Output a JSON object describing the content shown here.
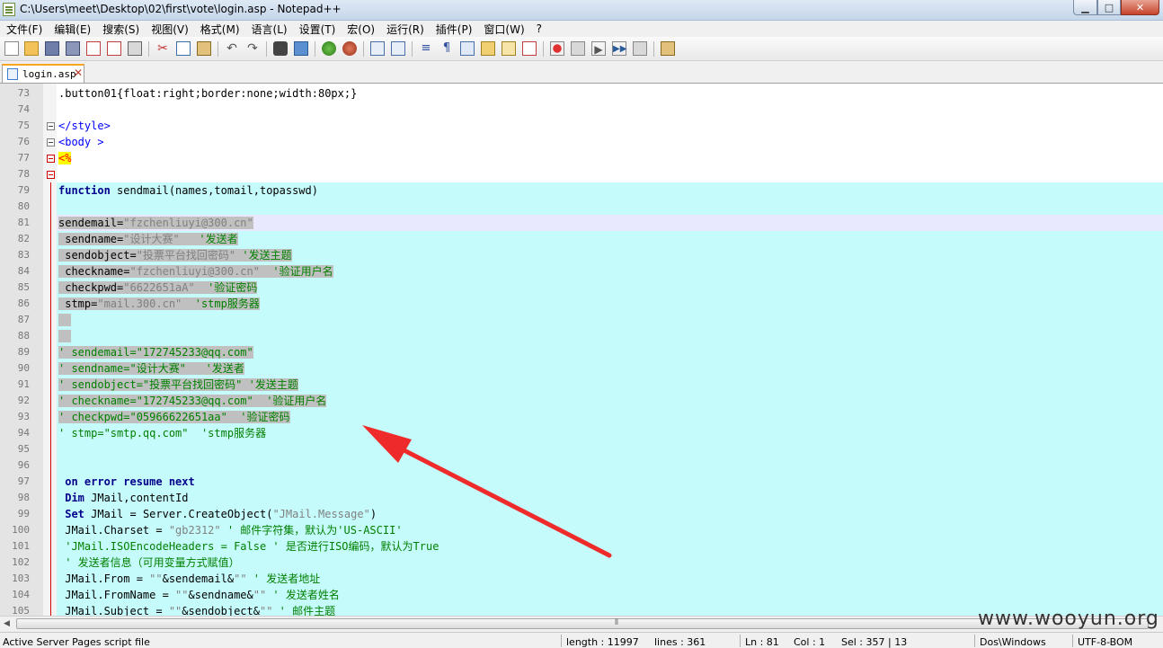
{
  "window": {
    "title": "C:\\Users\\meet\\Desktop\\02\\first\\vote\\login.asp - Notepad++",
    "min_glyph": "▁",
    "max_glyph": "□",
    "close_glyph": "✕"
  },
  "menu": [
    "文件(F)",
    "编辑(E)",
    "搜索(S)",
    "视图(V)",
    "格式(M)",
    "语言(L)",
    "设置(T)",
    "宏(O)",
    "运行(R)",
    "插件(P)",
    "窗口(W)",
    "?"
  ],
  "tab": {
    "label": "login.asp",
    "close": "✕"
  },
  "lines": [
    {
      "n": "73",
      "segs": [
        {
          "t": ".button01{float:right;border:none;width:80px;}",
          "c": ""
        }
      ]
    },
    {
      "n": "74",
      "segs": []
    },
    {
      "n": "75",
      "segs": [
        {
          "t": "</style>",
          "c": "tag"
        }
      ]
    },
    {
      "n": "76",
      "segs": [
        {
          "t": "<body >",
          "c": "tag"
        }
      ]
    },
    {
      "n": "77",
      "segs": [
        {
          "t": "<%",
          "c": "hl"
        }
      ]
    },
    {
      "n": "78",
      "segs": []
    },
    {
      "n": "79",
      "segs": [
        {
          "t": "function",
          "c": "kw"
        },
        {
          "t": " sendmail(names,tomail,topasswd)",
          "c": ""
        }
      ]
    },
    {
      "n": "80",
      "segs": []
    },
    {
      "n": "81",
      "segs": [
        {
          "t": "sendemail=",
          "c": "sel"
        },
        {
          "t": "\"fzchenliuyi@300.cn\"",
          "c": "sel str"
        }
      ]
    },
    {
      "n": "82",
      "segs": [
        {
          "t": " sendname=",
          "c": "sel"
        },
        {
          "t": "\"设计大赛\"",
          "c": "sel str"
        },
        {
          "t": "   '发送者",
          "c": "sel cm"
        }
      ]
    },
    {
      "n": "83",
      "segs": [
        {
          "t": " sendobject=",
          "c": "sel"
        },
        {
          "t": "\"投票平台找回密码\"",
          "c": "sel str"
        },
        {
          "t": " '发送主题",
          "c": "sel cm"
        }
      ]
    },
    {
      "n": "84",
      "segs": [
        {
          "t": " checkname=",
          "c": "sel"
        },
        {
          "t": "\"fzchenliuyi@300.cn\"",
          "c": "sel str"
        },
        {
          "t": "  '验证用户名",
          "c": "sel cm"
        }
      ]
    },
    {
      "n": "85",
      "segs": [
        {
          "t": " checkpwd=",
          "c": "sel"
        },
        {
          "t": "\"6622651aA\"",
          "c": "sel str"
        },
        {
          "t": "  '验证密码",
          "c": "sel cm"
        }
      ]
    },
    {
      "n": "86",
      "segs": [
        {
          "t": " stmp=",
          "c": "sel"
        },
        {
          "t": "\"mail.300.cn\"",
          "c": "sel str"
        },
        {
          "t": "  'stmp服务器",
          "c": "sel cm"
        }
      ]
    },
    {
      "n": "87",
      "segs": [
        {
          "t": "  ",
          "c": "sel"
        }
      ]
    },
    {
      "n": "88",
      "segs": [
        {
          "t": "  ",
          "c": "sel"
        }
      ]
    },
    {
      "n": "89",
      "segs": [
        {
          "t": "' sendemail=\"172745233@qq.com\"",
          "c": "sel cm"
        }
      ]
    },
    {
      "n": "90",
      "segs": [
        {
          "t": "' sendname=\"设计大赛\"   '发送者",
          "c": "sel cm"
        }
      ]
    },
    {
      "n": "91",
      "segs": [
        {
          "t": "' sendobject=\"投票平台找回密码\" '发送主题",
          "c": "sel cm"
        }
      ]
    },
    {
      "n": "92",
      "segs": [
        {
          "t": "' checkname=\"172745233@qq.com\"  '验证用户名",
          "c": "sel cm"
        }
      ]
    },
    {
      "n": "93",
      "segs": [
        {
          "t": "' checkpwd=\"05966622651aa\"  '验证密码",
          "c": "sel cm"
        }
      ]
    },
    {
      "n": "94",
      "segs": [
        {
          "t": "' stmp=\"smtp.qq.com\"  'stmp服务器",
          "c": "cm"
        }
      ]
    },
    {
      "n": "95",
      "segs": []
    },
    {
      "n": "96",
      "segs": []
    },
    {
      "n": "97",
      "segs": [
        {
          "t": " ",
          "c": ""
        },
        {
          "t": "on error resume next",
          "c": "kw"
        }
      ]
    },
    {
      "n": "98",
      "segs": [
        {
          "t": " ",
          "c": ""
        },
        {
          "t": "Dim",
          "c": "kw"
        },
        {
          "t": " JMail,contentId",
          "c": ""
        }
      ]
    },
    {
      "n": "99",
      "segs": [
        {
          "t": " ",
          "c": ""
        },
        {
          "t": "Set",
          "c": "kw"
        },
        {
          "t": " JMail = Server.CreateObject(",
          "c": ""
        },
        {
          "t": "\"JMail.Message\"",
          "c": "str"
        },
        {
          "t": ")",
          "c": ""
        }
      ]
    },
    {
      "n": "100",
      "segs": [
        {
          "t": " JMail.Charset = ",
          "c": ""
        },
        {
          "t": "\"gb2312\"",
          "c": "str"
        },
        {
          "t": " ' 邮件字符集，默认为'US-ASCII'",
          "c": "cm"
        }
      ]
    },
    {
      "n": "101",
      "segs": [
        {
          "t": " 'JMail.ISOEncodeHeaders = False ' 是否进行ISO编码，默认为True",
          "c": "cm"
        }
      ]
    },
    {
      "n": "102",
      "segs": [
        {
          "t": " ' 发送者信息（可用变量方式赋值）",
          "c": "cm"
        }
      ]
    },
    {
      "n": "103",
      "segs": [
        {
          "t": " JMail.From = ",
          "c": ""
        },
        {
          "t": "\"\"",
          "c": "str"
        },
        {
          "t": "&sendemail&",
          "c": ""
        },
        {
          "t": "\"\"",
          "c": "str"
        },
        {
          "t": " ' 发送者地址",
          "c": "cm"
        }
      ]
    },
    {
      "n": "104",
      "segs": [
        {
          "t": " JMail.FromName = ",
          "c": ""
        },
        {
          "t": "\"\"",
          "c": "str"
        },
        {
          "t": "&sendname&",
          "c": ""
        },
        {
          "t": "\"\"",
          "c": "str"
        },
        {
          "t": " ' 发送者姓名",
          "c": "cm"
        }
      ]
    },
    {
      "n": "105",
      "segs": [
        {
          "t": " JMail.Subject = ",
          "c": ""
        },
        {
          "t": "\"\"",
          "c": "str"
        },
        {
          "t": "&sendobject&",
          "c": ""
        },
        {
          "t": "\"\"",
          "c": "str"
        },
        {
          "t": " ' 邮件主题",
          "c": "cm"
        }
      ]
    }
  ],
  "hscroll": {
    "left_arrow": "◀",
    "grip": "⦀"
  },
  "status": {
    "file_type": "Active Server Pages script file",
    "length": "length : 11997",
    "lines": "lines : 361",
    "ln": "Ln : 81",
    "col": "Col : 1",
    "sel": "Sel : 357 | 13",
    "eol": "Dos\\Windows",
    "encoding": "UTF-8-BOM"
  },
  "watermark": "www.wooyun.org",
  "colors": {
    "arrow": "#ee2a2a",
    "cyan_block": "#c6fbfb",
    "selection": "#c0c0c0"
  }
}
